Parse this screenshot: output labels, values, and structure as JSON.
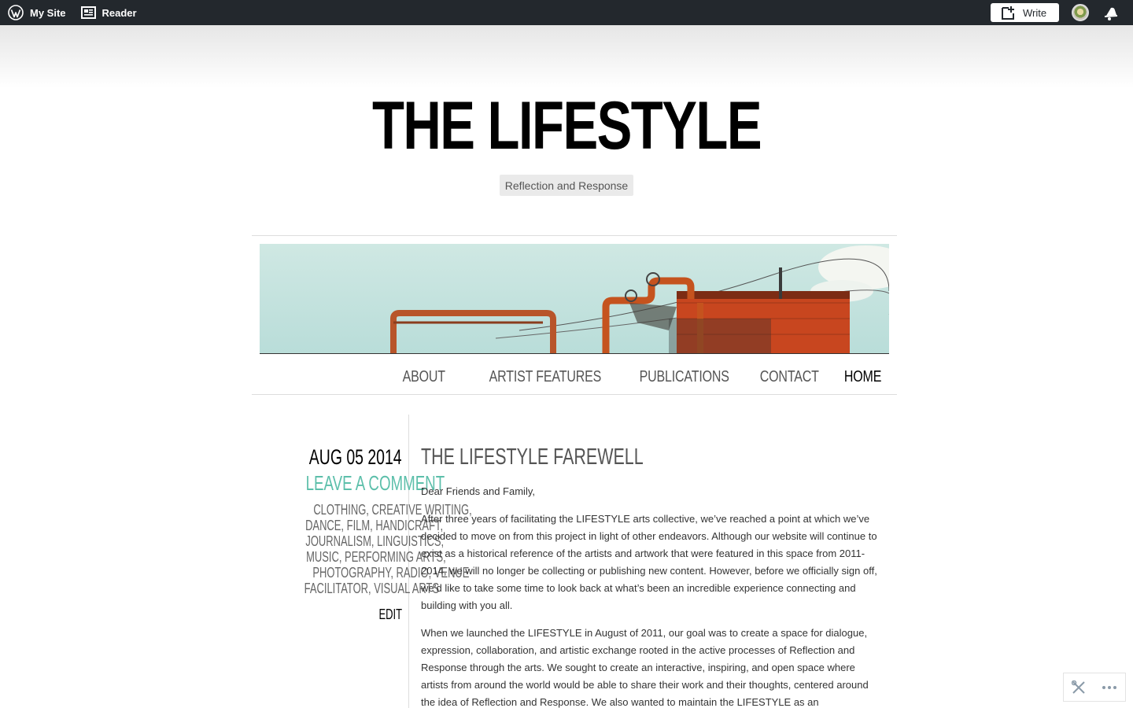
{
  "admin_bar": {
    "my_site_label": "My Site",
    "reader_label": "Reader",
    "write_label": "Write",
    "icons": [
      "wordpress-logo-icon",
      "reader-icon",
      "write-icon",
      "avatar",
      "notifications-bell-icon"
    ]
  },
  "site": {
    "title": "THE LIFESTYLE",
    "tagline": "Reflection and Response"
  },
  "nav": {
    "items": [
      {
        "label": "ABOUT"
      },
      {
        "label": "ARTIST FEATURES"
      },
      {
        "label": "PUBLICATIONS"
      },
      {
        "label": "CONTACT"
      },
      {
        "label": "HOME",
        "current": true
      }
    ]
  },
  "post": {
    "date": "AUG 05 2014",
    "leave_comment": "LEAVE A COMMENT",
    "category_rows": [
      [
        "CLOTHING",
        "CREATIVE WRITING"
      ],
      [
        "DANCE",
        "FILM",
        "HANDICRAFT"
      ],
      [
        "JOURNALISM",
        "LINGUISTICS"
      ],
      [
        "MUSIC",
        "PERFORMING ARTS"
      ],
      [
        "PHOTOGRAPHY",
        "RADIO",
        "VENUE"
      ],
      [
        "FACILITATOR",
        "VISUAL ARTS"
      ]
    ],
    "edit_label": "EDIT",
    "title": "THE LIFESTYLE FAREWELL",
    "paragraphs": [
      "Dear Friends and Family,",
      "After three years of facilitating the LIFESTYLE arts collective, we’ve reached a point at which we’ve decided to move on from this project in light of other endeavors. Although our website will continue to exist as a historical reference of the artists and artwork that were featured in this space from 2011-2014, we will no longer be collecting or publishing new content. However, before we officially sign off, we’d like to take some time to look back at what’s been an incredible experience connecting and building with you all.",
      "When we launched the LIFESTYLE in August of 2011, our goal was to create a space for dialogue, expression, collaboration, and artistic exchange rooted in the active processes of Reflection and Response through the arts. We sought to create an interactive, inspiring, and open space where artists from around the world would be able to share their work and their thoughts, centered around the idea of Reflection and Response. We also wanted to maintain the LIFESTYLE as an"
    ]
  },
  "colors": {
    "admin_bar_bg": "#23282d",
    "accent_teal": "#5cbfaa",
    "title_black": "#000000",
    "meta_gray": "#666666"
  },
  "float_tools": {
    "icons": [
      "tools-icon",
      "more-dots-icon"
    ]
  }
}
